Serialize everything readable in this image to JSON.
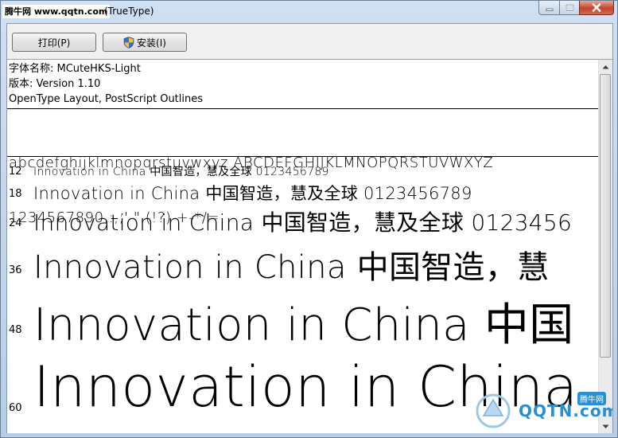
{
  "window": {
    "brand": "腾牛网 www.qqtn.com",
    "title_suffix": "(TrueType)",
    "buttons": {
      "minimize_icon": "minimize-icon",
      "maximize_icon": "maximize-icon",
      "close_icon": "close-icon"
    }
  },
  "toolbar": {
    "print_label": "打印(P)",
    "install_label": "安装(I)",
    "install_icon": "uac-shield-icon"
  },
  "font_info": {
    "name_line": "字体名称: MCuteHKS-Light",
    "version_line": "版本: Version 1.10",
    "format_line": "OpenType Layout, PostScript Outlines"
  },
  "charset": {
    "line1": "abcdefghijklmnopqrstuvwxyz ABCDEFGHIJKLMNOPQRSTUVWXYZ",
    "line2": "1234567890.:,;' \" (!?) +-*/="
  },
  "samples": [
    {
      "size": "12",
      "text": "Innovation in China 中国智造，慧及全球 0123456789"
    },
    {
      "size": "18",
      "text": "Innovation in China 中国智造，慧及全球 0123456789"
    },
    {
      "size": "24",
      "text": "Innovation in China 中国智造，慧及全球 0123456"
    },
    {
      "size": "36",
      "text": "Innovation in China 中国智造，慧"
    },
    {
      "size": "48",
      "text": "Innovation in China 中国"
    },
    {
      "size": "60",
      "text": "Innovation in China"
    }
  ],
  "watermark": {
    "text": "QQTN.com",
    "badge": "腾牛网"
  },
  "colors": {
    "title_bg": "#c5d9ef",
    "close_red": "#c3442b",
    "content_bg": "#ffffff",
    "watermark_blue": "#2a8fd0"
  }
}
